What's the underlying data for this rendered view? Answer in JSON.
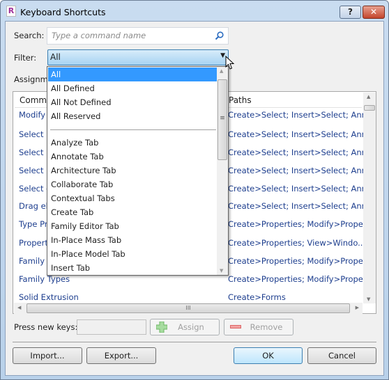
{
  "window": {
    "title": "Keyboard Shortcuts",
    "app_icon_letter": "R",
    "help_label": "?",
    "close_label": "✕"
  },
  "search": {
    "label": "Search:",
    "placeholder": "Type a command name",
    "icon": "search-icon"
  },
  "filter": {
    "label": "Filter:",
    "value": "All",
    "options": [
      "All",
      "All Defined",
      "All Not Defined",
      "All Reserved",
      "Analyze Tab",
      "Annotate Tab",
      "Architecture Tab",
      "Collaborate Tab",
      "Contextual Tabs",
      "Create Tab",
      "Family Editor Tab",
      "In-Place Mass Tab",
      "In-Place Model Tab",
      "Insert Tab"
    ],
    "selected_index": 0
  },
  "assignments_label": "Assignme",
  "table": {
    "headers": [
      "Comma",
      "Paths"
    ],
    "rows": [
      [
        "Modify",
        "Create>Select; Insert>Select; Ann..."
      ],
      [
        "Select li",
        "Create>Select; Insert>Select; Ann..."
      ],
      [
        "Select u",
        "Create>Select; Insert>Select; Ann..."
      ],
      [
        "Select p",
        "Create>Select; Insert>Select; Ann..."
      ],
      [
        "Select e",
        "Create>Select; Insert>Select; Ann..."
      ],
      [
        "Drag ele",
        "Create>Select; Insert>Select; Ann..."
      ],
      [
        "Type Pr",
        "Create>Properties; Modify>Prope..."
      ],
      [
        "Properti",
        "Create>Properties; View>Windo..."
      ],
      [
        "Family C",
        "Create>Properties; Modify>Prope..."
      ],
      [
        "Family Types",
        "Create>Properties; Modify>Prope..."
      ],
      [
        "Solid Extrusion",
        "Create>Forms"
      ]
    ]
  },
  "keys": {
    "label": "Press new keys:",
    "value": "",
    "assign_label": "Assign",
    "remove_label": "Remove"
  },
  "buttons": {
    "import": "Import...",
    "export": "Export...",
    "ok": "OK",
    "cancel": "Cancel"
  },
  "colors": {
    "selection": "#3399ff",
    "link_text": "#1d3e8e",
    "assign_icon": "#7cc576",
    "remove_icon": "#e07070"
  }
}
